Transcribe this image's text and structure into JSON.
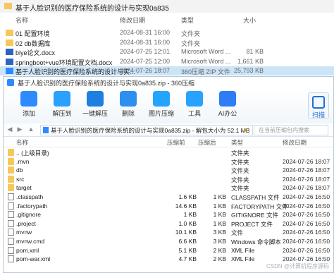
{
  "explorer": {
    "title": "基于人脸识别的医疗保险系统的设计与实现0a835",
    "columns": {
      "name": "名称",
      "date": "修改日期",
      "type": "类型",
      "size": "大小"
    },
    "rows": [
      {
        "name": "01 配置环境",
        "date": "2024-08-31 16:00",
        "type": "文件夹",
        "size": "",
        "kind": "folder"
      },
      {
        "name": "02 db数据库",
        "date": "2024-08-31 16:00",
        "type": "文件夹",
        "size": "",
        "kind": "folder"
      },
      {
        "name": "biye论文.docx",
        "date": "2024-07-25 12:01",
        "type": "Microsoft Word ...",
        "size": "81 KB",
        "kind": "doc"
      },
      {
        "name": "springboot+vue环境配置文档.docx",
        "date": "2024-07-25 12:00",
        "type": "Microsoft Word ...",
        "size": "1,661 KB",
        "kind": "doc"
      },
      {
        "name": "基于人脸识别的医疗保险系统的设计与实...",
        "date": "2024-07-26 18:07",
        "type": "360压缩 ZIP 文件",
        "size": "25,793 KB",
        "kind": "zip"
      }
    ]
  },
  "zip": {
    "title": "基于人脸识别的医疗保险系统的设计与实现0a835.zip - 360压缩",
    "toolbar": [
      {
        "label": "添加",
        "icon": "add-icon",
        "color": "#2e8bff"
      },
      {
        "label": "解压到",
        "icon": "extract-to-icon",
        "color": "#2aa0ff"
      },
      {
        "label": "一键解压",
        "icon": "one-click-extract-icon",
        "color": "#1e7fe0"
      },
      {
        "label": "删除",
        "icon": "delete-icon",
        "color": "#2d8ff0"
      },
      {
        "label": "图片压缩",
        "icon": "image-compress-icon",
        "color": "#22a4ff"
      },
      {
        "label": "工具",
        "icon": "tools-icon",
        "color": "#28a2ff"
      },
      {
        "label": "AI办公",
        "icon": "ai-office-icon",
        "color": "#2e7cf6"
      }
    ],
    "scan_label": "扫描",
    "address": "基于人脸识别的医疗保险系统的设计与实现0a835.zip - 解包大小为 52.1 MB",
    "search_placeholder": "在当前压缩包内搜索",
    "columns": {
      "name": "名称",
      "size": "压缩前",
      "compressed": "压缩后",
      "type": "类型",
      "date": "修改日期"
    },
    "rows": [
      {
        "name": ".. (上级目录)",
        "size": "",
        "compressed": "",
        "type": "文件夹",
        "date": "",
        "kind": "folder"
      },
      {
        "name": ".mvn",
        "size": "",
        "compressed": "",
        "type": "文件夹",
        "date": "2024-07-26 18:07",
        "kind": "folder"
      },
      {
        "name": "db",
        "size": "",
        "compressed": "",
        "type": "文件夹",
        "date": "2024-07-26 18:07",
        "kind": "folder"
      },
      {
        "name": "src",
        "size": "",
        "compressed": "",
        "type": "文件夹",
        "date": "2024-07-26 18:07",
        "kind": "folder"
      },
      {
        "name": "target",
        "size": "",
        "compressed": "",
        "type": "文件夹",
        "date": "2024-07-26 18:07",
        "kind": "folder"
      },
      {
        "name": ".classpath",
        "size": "1.6 KB",
        "compressed": "1 KB",
        "type": "CLASSPATH 文件",
        "date": "2024-07-26 16:50",
        "kind": "file"
      },
      {
        "name": ".factorypath",
        "size": "14.6 KB",
        "compressed": "1 KB",
        "type": "FACTORYPATH 文件",
        "date": "2024-07-26 16:50",
        "kind": "file"
      },
      {
        "name": ".gitignore",
        "size": "1 KB",
        "compressed": "1 KB",
        "type": "GITIGNORE 文件",
        "date": "2024-07-26 16:50",
        "kind": "file"
      },
      {
        "name": ".project",
        "size": "1.0 KB",
        "compressed": "1 KB",
        "type": "PROJECT 文件",
        "date": "2024-07-26 16:50",
        "kind": "file"
      },
      {
        "name": "mvnw",
        "size": "10.1 KB",
        "compressed": "3 KB",
        "type": "文件",
        "date": "2024-07-26 16:50",
        "kind": "file"
      },
      {
        "name": "mvnw.cmd",
        "size": "6.6 KB",
        "compressed": "3 KB",
        "type": "Windows 命令脚本",
        "date": "2024-07-26 16:50",
        "kind": "file"
      },
      {
        "name": "pom.xml",
        "size": "5.1 KB",
        "compressed": "2 KB",
        "type": "XML File",
        "date": "2024-07-26 16:50",
        "kind": "file"
      },
      {
        "name": "pom-war.xml",
        "size": "4.7 KB",
        "compressed": "2 KB",
        "type": "XML File",
        "date": "2024-07-26 16:50",
        "kind": "file"
      }
    ]
  },
  "watermark": "CSDN @计算机程序源码"
}
